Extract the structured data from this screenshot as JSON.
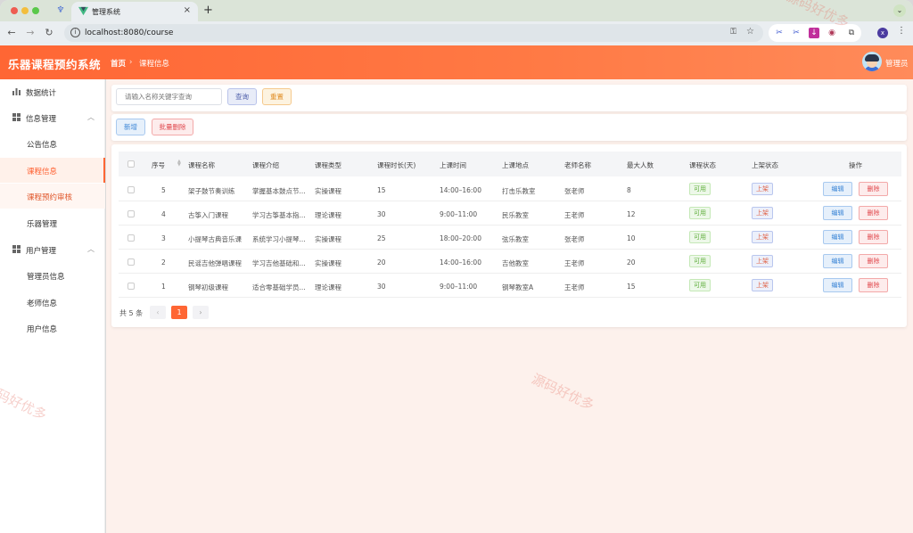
{
  "browser": {
    "tab_title": "管理系统",
    "url": "localhost:8080/course",
    "profile_initial": "x"
  },
  "header": {
    "app_title": "乐器课程预约系统",
    "breadcrumb_home": "首页",
    "breadcrumb_separator": "›",
    "breadcrumb_current": "课程信息",
    "user_name": "管理员"
  },
  "sidebar": {
    "items": [
      {
        "label": "数据统计",
        "icon": "bar-chart-icon"
      },
      {
        "label": "信息管理",
        "icon": "grid-icon"
      },
      {
        "label": "公告信息"
      },
      {
        "label": "课程信息"
      },
      {
        "label": "课程预约审核"
      },
      {
        "label": "乐器管理"
      },
      {
        "label": "用户管理",
        "icon": "grid-icon"
      },
      {
        "label": "管理员信息"
      },
      {
        "label": "老师信息"
      },
      {
        "label": "用户信息"
      }
    ]
  },
  "search": {
    "placeholder": "请输入名称关键字查询",
    "query_label": "查询",
    "reset_label": "重置"
  },
  "actions": {
    "add_label": "新增",
    "batch_delete_label": "批量删除"
  },
  "table": {
    "columns": [
      "序号",
      "课程名称",
      "课程介绍",
      "课程类型",
      "课程时长(天)",
      "上课时间",
      "上课地点",
      "老师名称",
      "最大人数",
      "课程状态",
      "上架状态",
      "操作"
    ],
    "rows": [
      {
        "id": "5",
        "name": "架子鼓节奏训练",
        "intro": "掌握基本鼓点节...",
        "type": "实操课程",
        "duration": "15",
        "time": "14:00–16:00",
        "place": "打击乐教室",
        "teacher": "张老师",
        "max": "8",
        "status": "可用",
        "shelf": "上架"
      },
      {
        "id": "4",
        "name": "古筝入门课程",
        "intro": "学习古筝基本指...",
        "type": "理论课程",
        "duration": "30",
        "time": "9:00–11:00",
        "place": "民乐教室",
        "teacher": "王老师",
        "max": "12",
        "status": "可用",
        "shelf": "上架"
      },
      {
        "id": "3",
        "name": "小提琴古典音乐课",
        "intro": "系统学习小提琴...",
        "type": "实操课程",
        "duration": "25",
        "time": "18:00–20:00",
        "place": "弦乐教室",
        "teacher": "张老师",
        "max": "10",
        "status": "可用",
        "shelf": "上架"
      },
      {
        "id": "2",
        "name": "民谣吉他弹唱课程",
        "intro": "学习吉他基础和...",
        "type": "实操课程",
        "duration": "20",
        "time": "14:00–16:00",
        "place": "吉他教室",
        "teacher": "王老师",
        "max": "20",
        "status": "可用",
        "shelf": "上架"
      },
      {
        "id": "1",
        "name": "钢琴初级课程",
        "intro": "适合零基础学员...",
        "type": "理论课程",
        "duration": "30",
        "time": "9:00–11:00",
        "place": "钢琴教室A",
        "teacher": "王老师",
        "max": "15",
        "status": "可用",
        "shelf": "上架"
      }
    ],
    "edit_label": "编辑",
    "delete_label": "删除"
  },
  "pagination": {
    "total_text": "共 5 条",
    "current_page": "1",
    "prev": "‹",
    "next": "›"
  },
  "watermark": "源码好优多",
  "colors": {
    "brand": "#ff6634",
    "active_bg": "#fff1ea",
    "status_green": "#5fae3c",
    "danger": "#e0474c",
    "primary": "#3a85d6"
  }
}
